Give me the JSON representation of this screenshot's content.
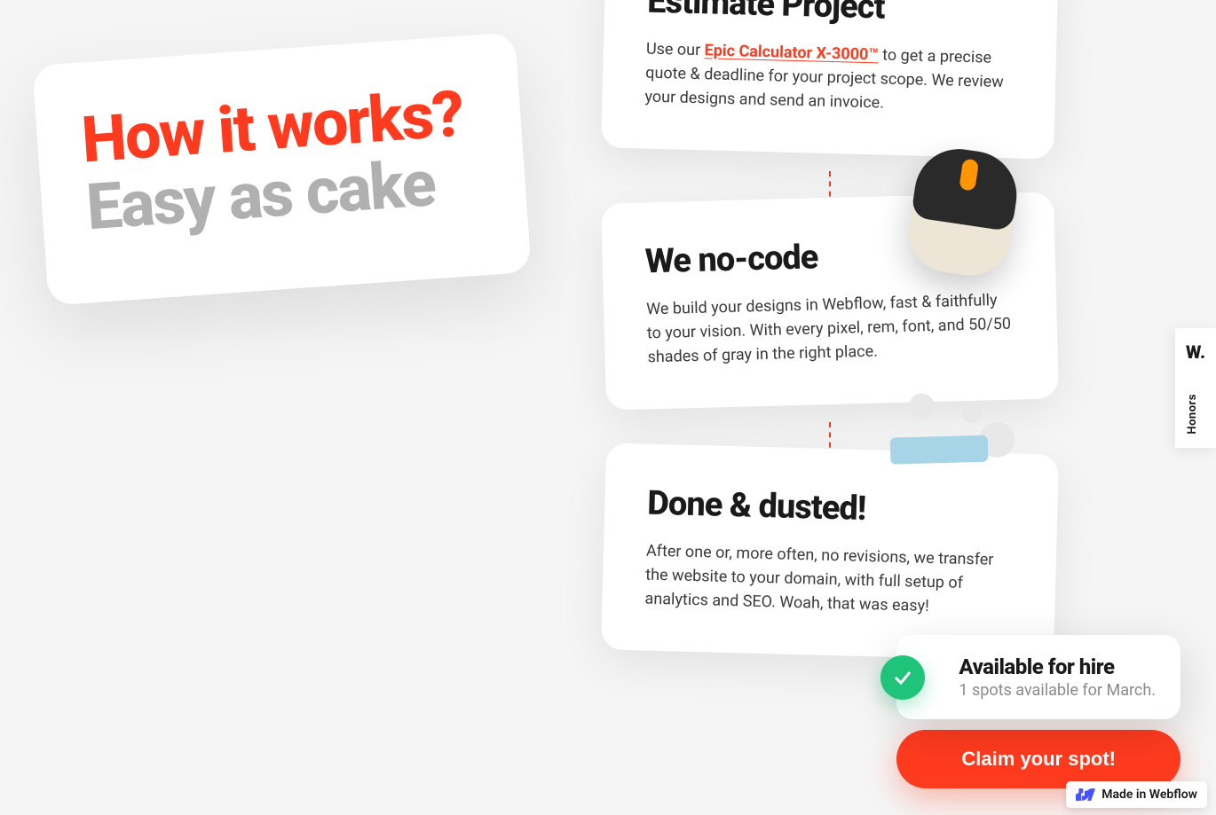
{
  "hero": {
    "title_line1": "How it works?",
    "title_line2": "Easy as cake"
  },
  "steps": [
    {
      "title": "Estimate Project",
      "text_before": "Use our ",
      "link_text": "Epic Calculator X-3000™",
      "text_after": " to get a precise quote & deadline for your project scope. We review your designs and send an invoice."
    },
    {
      "title": "We no-code",
      "text": "We build your designs in Webflow, fast & faithfully to your vision. With every pixel, rem, font, and 50/50 shades of gray in the right place."
    },
    {
      "title": "Done & dusted!",
      "text": "After one or, more often, no revisions, we transfer the website to your domain, with full setup of analytics and SEO. Woah, that was easy!"
    }
  ],
  "cta": {
    "title": "Available for hire",
    "subtitle": "1 spots available for March.",
    "button": "Claim your spot!"
  },
  "webflow_badge": "Made in Webflow",
  "honors": {
    "logo": "W.",
    "label": "Honors"
  }
}
